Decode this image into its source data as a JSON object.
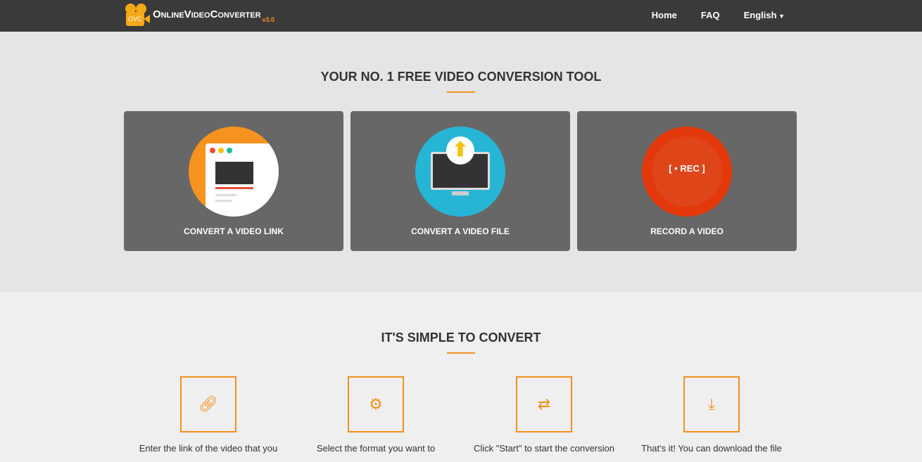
{
  "nav": {
    "logo_text": "OVC",
    "brand": "OnlineVideoConverter",
    "version": "v3.0",
    "links": [
      "Home",
      "FAQ",
      "English"
    ]
  },
  "hero": {
    "title": "YOUR NO. 1 FREE VIDEO CONVERSION TOOL",
    "cards": [
      {
        "label": "CONVERT A VIDEO LINK"
      },
      {
        "label": "CONVERT A VIDEO FILE"
      },
      {
        "label": "RECORD A VIDEO",
        "badge": "REC"
      }
    ]
  },
  "steps": {
    "title": "IT'S SIMPLE TO CONVERT",
    "items": [
      {
        "icon": "link-icon",
        "text": "Enter the link of the video that you"
      },
      {
        "icon": "gears-icon",
        "text": "Select the format you want to"
      },
      {
        "icon": "exchange-icon",
        "text": "Click \"Start\" to start the conversion"
      },
      {
        "icon": "download-icon",
        "text": "That's it! You can download the file"
      }
    ]
  }
}
